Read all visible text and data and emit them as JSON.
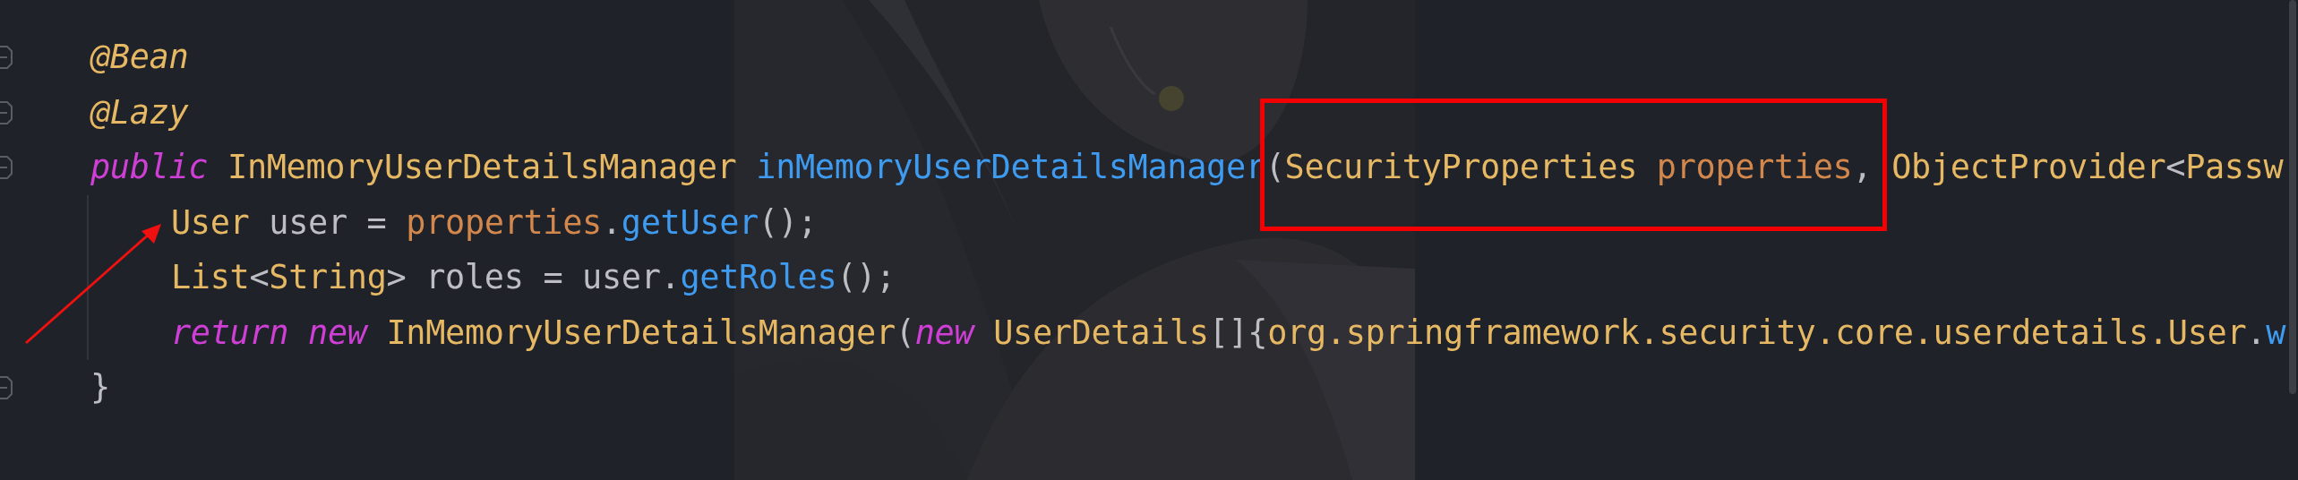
{
  "editor": {
    "lines": [
      {
        "fold_marker": true,
        "tokens": [
          {
            "kind": "annotation",
            "text": "@Bean"
          }
        ]
      },
      {
        "fold_marker": true,
        "tokens": [
          {
            "kind": "annotation",
            "text": "@Lazy"
          }
        ]
      },
      {
        "fold_marker": true,
        "tokens": [
          {
            "kind": "keyword",
            "text": "public "
          },
          {
            "kind": "type",
            "text": "InMemoryUserDetailsManager "
          },
          {
            "kind": "method",
            "text": "inMemoryUserDetailsManager"
          },
          {
            "kind": "plain",
            "text": "("
          },
          {
            "kind": "type",
            "text": "SecurityProperties "
          },
          {
            "kind": "param",
            "text": "properties"
          },
          {
            "kind": "plain",
            "text": ", "
          },
          {
            "kind": "type",
            "text": "ObjectProvider"
          },
          {
            "kind": "plain",
            "text": "<"
          },
          {
            "kind": "type",
            "text": "Passw"
          }
        ],
        "children": [
          {
            "fold_marker": false,
            "tokens": [
              {
                "kind": "type",
                "text": "User"
              },
              {
                "kind": "plain",
                "text": " user = "
              },
              {
                "kind": "param",
                "text": "properties"
              },
              {
                "kind": "plain",
                "text": "."
              },
              {
                "kind": "method",
                "text": "getUser"
              },
              {
                "kind": "plain",
                "text": "();"
              }
            ]
          },
          {
            "fold_marker": false,
            "tokens": [
              {
                "kind": "type",
                "text": "List"
              },
              {
                "kind": "plain",
                "text": "<"
              },
              {
                "kind": "type",
                "text": "String"
              },
              {
                "kind": "plain",
                "text": "> roles = user."
              },
              {
                "kind": "method",
                "text": "getRoles"
              },
              {
                "kind": "plain",
                "text": "();"
              }
            ]
          },
          {
            "fold_marker": false,
            "tokens": [
              {
                "kind": "keyword",
                "text": "return new "
              },
              {
                "kind": "type",
                "text": "InMemoryUserDetailsManager"
              },
              {
                "kind": "plain",
                "text": "("
              },
              {
                "kind": "keyword",
                "text": "new "
              },
              {
                "kind": "type",
                "text": "UserDetails"
              },
              {
                "kind": "plain",
                "text": "[]{"
              },
              {
                "kind": "type",
                "text": "org.springframework.security.core.userdetails.User"
              },
              {
                "kind": "plain",
                "text": "."
              },
              {
                "kind": "method",
                "text": "w"
              }
            ]
          }
        ]
      },
      {
        "fold_marker": true,
        "tokens": [
          {
            "kind": "plain",
            "text": "}"
          }
        ]
      }
    ]
  },
  "highlight_box": true,
  "arrow": true
}
